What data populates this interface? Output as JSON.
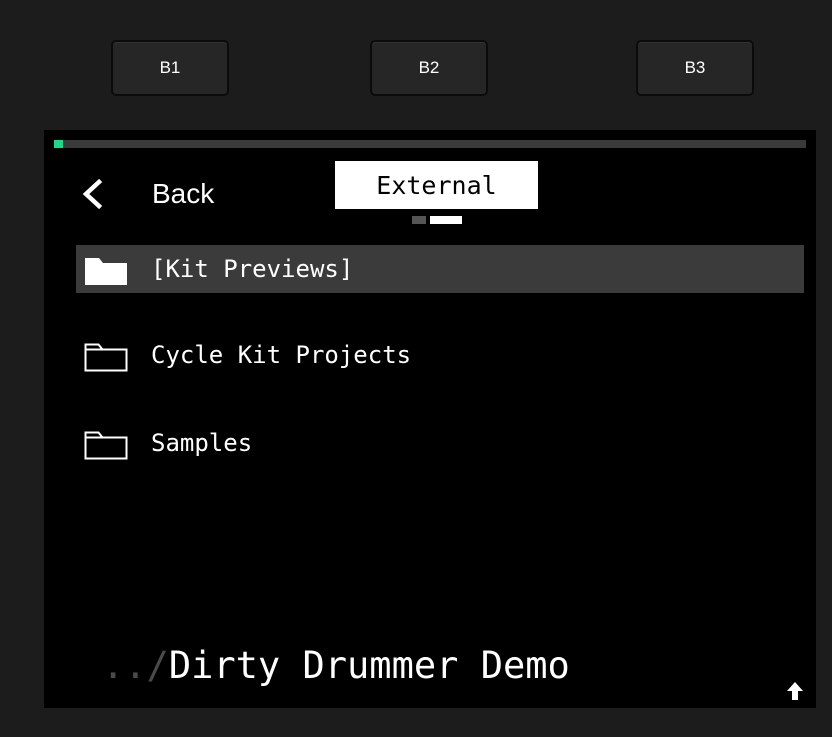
{
  "buttons": {
    "b1": "B1",
    "b2": "B2",
    "b3": "B3"
  },
  "screen": {
    "progress": 0.012,
    "accent_color": "#1fd98a",
    "back_label": "Back",
    "back_icon": "chevron-left-icon",
    "location": "External",
    "page_indicator": {
      "pages": 2,
      "active": 2
    },
    "items": [
      {
        "name": "[Kit Previews]",
        "icon": "folder-filled-icon",
        "selected": true
      },
      {
        "name": "Cycle Kit Projects",
        "icon": "folder-outline-icon",
        "selected": false
      },
      {
        "name": "Samples",
        "icon": "folder-outline-icon",
        "selected": false
      }
    ],
    "path_prefix": "../",
    "current_folder": "Dirty Drummer Demo",
    "up_icon": "arrow-up-icon"
  }
}
